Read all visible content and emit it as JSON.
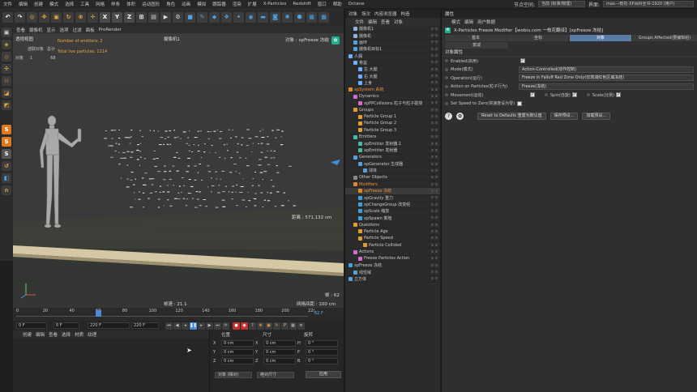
{
  "menubar": {
    "items": [
      "文件",
      "编辑",
      "创建",
      "模式",
      "选择",
      "工具",
      "网格",
      "样条",
      "体积",
      "运动图形",
      "角色",
      "动画",
      "模拟",
      "跟踪器",
      "渲染",
      "扩展",
      "X-Particles",
      "Redshift",
      "窗口",
      "帮助",
      "Octane"
    ],
    "node_space_label": "节点空间:",
    "node_space_value": "当前 (标准/物理)",
    "layout_label": "界面:",
    "layout_value": "max---枝花-XP百科全书-1920 (用户)"
  },
  "toolbar": {
    "axis_x": "X",
    "axis_y": "Y",
    "axis_z": "Z"
  },
  "viewport": {
    "menu": [
      "查看",
      "摄像机",
      "显示",
      "选项",
      "过滤",
      "面板",
      "ProRender"
    ],
    "view_name": "透视视图",
    "camera": "摄像机1",
    "object_label": "对象 : xpFreeze 冻结",
    "hud_selected": "选取对象",
    "hud_total": "总计",
    "hud_object": "对象",
    "hud_obj_num": "1",
    "hud_obj_count": "68",
    "emitters_info": "Number of emitters: 2",
    "particles_info": "Total live particles: 1214",
    "distance": "距离 : 571.132 cm",
    "frame_label": "帧 : 62",
    "fps": "帧速 : 21.1",
    "grid_spacing": "网格间距 : 100 cm"
  },
  "timeline": {
    "ticks": [
      "0",
      "20",
      "40",
      "60",
      "80",
      "100",
      "120",
      "140",
      "160",
      "180",
      "200",
      "22("
    ],
    "current_frame": "62 F",
    "playhead_value": 62,
    "range_max": 220,
    "start": "0 F",
    "start2": "0 F",
    "end": "220 F",
    "end2": "220 F"
  },
  "materials": {
    "menu": [
      "创建",
      "编辑",
      "查看",
      "选择",
      "材质",
      "纹理"
    ]
  },
  "coords": {
    "headers": [
      "位置",
      "尺寸",
      "旋转"
    ],
    "rows": [
      {
        "axis": "X",
        "pos": "0 cm",
        "size_axis": "X",
        "size": "0 cm",
        "rot_axis": "H",
        "rot": "0 °"
      },
      {
        "axis": "Y",
        "pos": "0 cm",
        "size_axis": "Y",
        "size": "0 cm",
        "rot_axis": "P",
        "rot": "0 °"
      },
      {
        "axis": "Z",
        "pos": "0 cm",
        "size_axis": "Z",
        "size": "0 cm",
        "rot_axis": "B",
        "rot": "0 °"
      }
    ],
    "mode1": "对象 (相对)",
    "mode2": "绝对尺寸",
    "apply": "应用"
  },
  "objmgr": {
    "tabs": [
      "对象",
      "场次",
      "内容浏览器",
      "构造"
    ],
    "menu": [
      "文件",
      "编辑",
      "查看",
      "对象"
    ],
    "items": [
      {
        "label": "摄像机1",
        "indent": 1,
        "color": "#8fb3d9"
      },
      {
        "label": "摄像机",
        "indent": 1,
        "color": "#8fb3d9"
      },
      {
        "label": "画环",
        "indent": 1,
        "color": "#5aa0d8"
      },
      {
        "label": "摄像机目标1",
        "indent": 1,
        "color": "#5aa0d8"
      },
      {
        "label": "人偶",
        "indent": 0,
        "color": "#6ab0ff"
      },
      {
        "label": "骨盆",
        "indent": 1,
        "color": "#6ab0ff"
      },
      {
        "label": "左 大腿",
        "indent": 2,
        "color": "#6ab0ff"
      },
      {
        "label": "右 大腿",
        "indent": 2,
        "color": "#6ab0ff"
      },
      {
        "label": "上身",
        "indent": 2,
        "color": "#6ab0ff"
      },
      {
        "label": "xpSystem 系统",
        "indent": 0,
        "color": "#e08a2a",
        "orange": true
      },
      {
        "label": "Dynamics",
        "indent": 1,
        "color": "#d06bd0"
      },
      {
        "label": "xpPPCollisions 粒子与粒子碰撞",
        "indent": 2,
        "color": "#d06bd0"
      },
      {
        "label": "Groups",
        "indent": 1,
        "color": "#e0a030"
      },
      {
        "label": "Particle Group 1",
        "indent": 2,
        "color": "#e0a030"
      },
      {
        "label": "Particle Group 2",
        "indent": 2,
        "color": "#e0a030"
      },
      {
        "label": "Particle Group 3",
        "indent": 2,
        "color": "#e0a030"
      },
      {
        "label": "Emitters",
        "indent": 1,
        "color": "#40c0a0"
      },
      {
        "label": "xpEmitter 发射器.1",
        "indent": 2,
        "color": "#40c0a0"
      },
      {
        "label": "xpEmitter 发射器",
        "indent": 2,
        "color": "#40c0a0"
      },
      {
        "label": "Generators",
        "indent": 1,
        "color": "#5aa0d8"
      },
      {
        "label": "xpGenerator 生成器",
        "indent": 2,
        "color": "#5aa0d8"
      },
      {
        "label": "球体",
        "indent": 3,
        "color": "#5aa0d8"
      },
      {
        "label": "Other Objects",
        "indent": 1,
        "color": "#888888"
      },
      {
        "label": "Modifiers",
        "indent": 1,
        "color": "#e08a2a",
        "orange": true
      },
      {
        "label": "xpFreeze 冻结",
        "indent": 2,
        "color": "#e08a2a",
        "orange": true,
        "selected": true
      },
      {
        "label": "xpGravity 重力",
        "indent": 2,
        "color": "#40a0e0"
      },
      {
        "label": "xpChangeGroup 改变组",
        "indent": 2,
        "color": "#40a0e0"
      },
      {
        "label": "xpScale 缩放",
        "indent": 2,
        "color": "#40a0e0"
      },
      {
        "label": "xpSpawn 繁殖",
        "indent": 2,
        "color": "#40a0e0"
      },
      {
        "label": "Questions",
        "indent": 1,
        "color": "#e0a030"
      },
      {
        "label": "Particle Age",
        "indent": 2,
        "color": "#e0a030"
      },
      {
        "label": "Particle Speed",
        "indent": 2,
        "color": "#e0a030"
      },
      {
        "label": "Particle Collided",
        "indent": 3,
        "color": "#e0a030"
      },
      {
        "label": "Actions",
        "indent": 1,
        "color": "#d06bd0"
      },
      {
        "label": "Freeze Particles Action",
        "indent": 2,
        "color": "#d06bd0"
      },
      {
        "label": "xpFreeze 冻结",
        "indent": 0,
        "color": "#40a0e0"
      },
      {
        "label": "线性域",
        "indent": 1,
        "color": "#5aa0d8"
      },
      {
        "label": "立方体",
        "indent": 0,
        "color": "#5aa0d8"
      }
    ]
  },
  "attrmgr": {
    "tab": "属性",
    "menu": [
      "模式",
      "编辑",
      "用户数据"
    ],
    "title": "X-Particles Freeze Modifier【wobiu.com 一枝花翻译】[xpFreeze 冻结]",
    "tabs": [
      "基本",
      "坐标",
      "对象",
      "Groups Affected(要编辑组)"
    ],
    "subtab": "衰减",
    "section": "对象属性",
    "enabled_label": "Enabled(启用)",
    "mode_label": "Mode(模式)",
    "mode_value": "Action-Controlled(动作控制)",
    "operation_label": "Operation(运行)",
    "operation_value": "Freeze in Falloff Red Zone Only(仅衰减红色区域冻结)",
    "action_label": "Action on Particles(粒子行为)",
    "action_value": "Freeze(冻结)",
    "movement_label": "Movement(运动)",
    "spin_label": "Spin(自旋)",
    "scale_label": "Scale(比例)",
    "zero_label": "Set Speed to Zero(将速度设为零)",
    "btn_reset": "Reset to Defaults 重置为默认值",
    "btn_save": "保存预设...",
    "btn_load": "加载预设..."
  }
}
